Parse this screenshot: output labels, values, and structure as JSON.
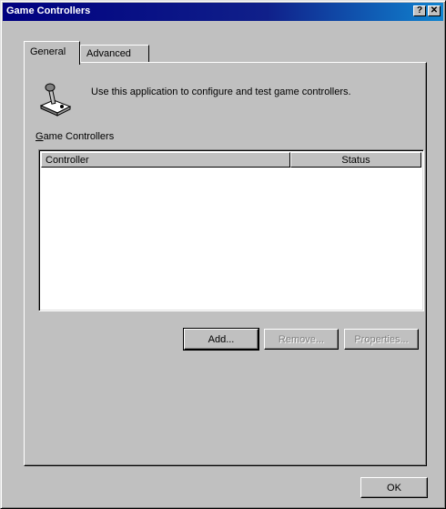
{
  "window": {
    "title": "Game Controllers",
    "help_glyph": "?",
    "close_glyph": "✕"
  },
  "tabs": [
    {
      "label": "General"
    },
    {
      "label": "Advanced"
    }
  ],
  "general": {
    "description": "Use this application to configure and test game controllers.",
    "section_label_first": "G",
    "section_label_rest": "ame Controllers",
    "columns": {
      "controller": "Controller",
      "status": "Status"
    },
    "rows": [],
    "buttons": {
      "add": "Add...",
      "remove": "Remove...",
      "properties": "Properties..."
    }
  },
  "footer": {
    "ok": "OK"
  },
  "colors": {
    "title_bar": "#000080",
    "title_bar_end": "#1084d0",
    "face": "#c0c0c0"
  },
  "icons": {
    "app": "joystick-icon"
  }
}
